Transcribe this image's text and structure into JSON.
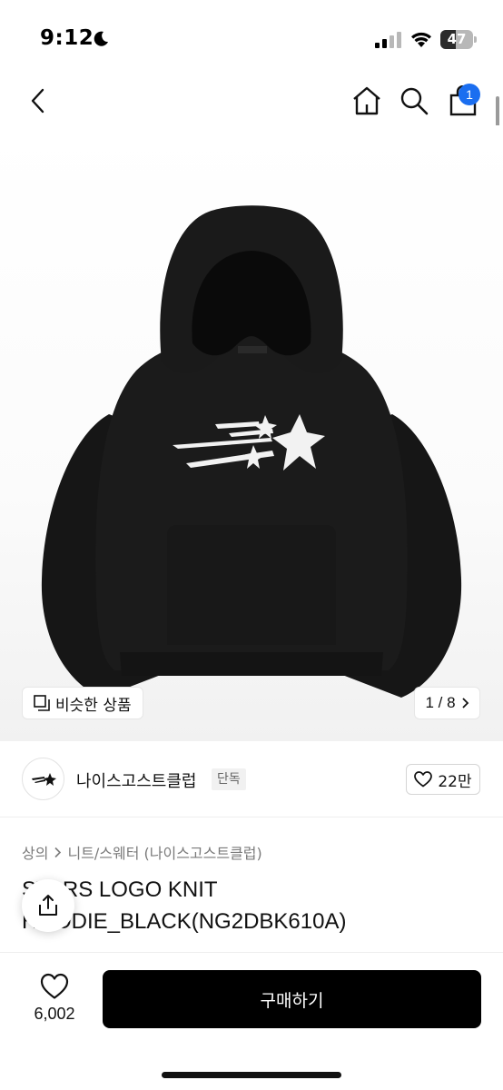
{
  "status_bar": {
    "time": "9:12",
    "battery": "47",
    "battery_level_percent": 47
  },
  "nav": {
    "cart_count": "1"
  },
  "gallery": {
    "similar_label": "비슷한 상품",
    "pager": "1 / 8"
  },
  "brand": {
    "name": "나이스고스트클럽",
    "badge": "단독",
    "likes": "22만"
  },
  "breadcrumb": {
    "level1": "상의",
    "level2": "니트/스웨터 (나이스고스트클럽)"
  },
  "product": {
    "title": "STARS LOGO KNIT HOODIE_BLACK(NG2DBK610A)"
  },
  "bottom_bar": {
    "wish_count": "6,002",
    "buy_label": "구매하기"
  },
  "colors": {
    "accent": "#1b6ef0",
    "buy_button": "#000000"
  }
}
